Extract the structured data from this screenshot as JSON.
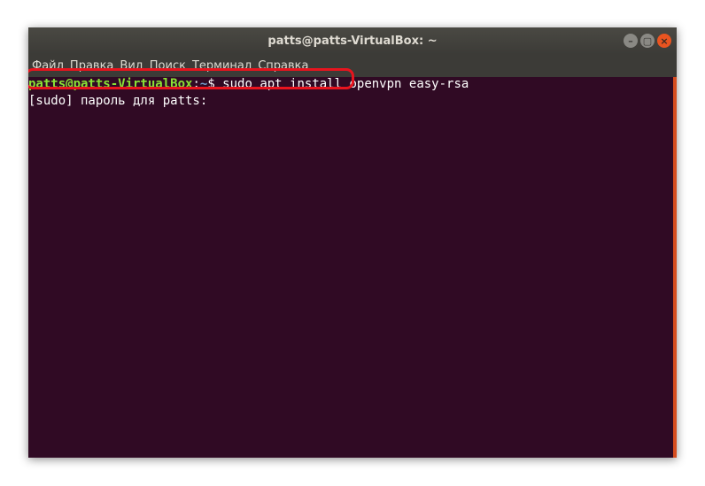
{
  "window": {
    "title": "patts@patts-VirtualBox: ~"
  },
  "controls": {
    "minimize_icon": "minimize-icon",
    "maximize_icon": "maximize-icon",
    "close_icon": "close-icon",
    "minimize_glyph": "–",
    "maximize_glyph": "▢",
    "close_glyph": "×"
  },
  "menu": {
    "items": [
      "Файл",
      "Правка",
      "Вид",
      "Поиск",
      "Терминал",
      "Справка"
    ]
  },
  "terminal": {
    "prompt_user": "patts@patts-VirtualBox",
    "prompt_sep": ":",
    "prompt_path": "~",
    "prompt_symbol": "$ ",
    "command": "sudo apt install openvpn easy-rsa",
    "password_prompt": "[sudo] пароль для patts:"
  },
  "colors": {
    "background": "#300a24",
    "prompt_user": "#8ae234",
    "prompt_path": "#729fcf",
    "highlight": "#e8141e",
    "accent": "#e95420"
  }
}
